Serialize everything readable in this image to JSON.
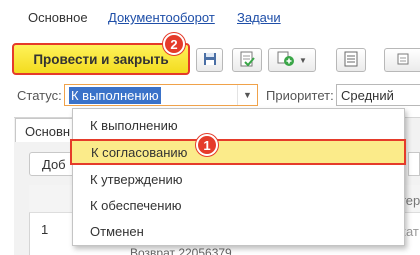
{
  "tabs": {
    "main": "Основное",
    "docflow": "Документооборот",
    "tasks": "Задачи"
  },
  "toolbar": {
    "post_close_label": "Провести и закрыть",
    "icons": [
      "save-icon",
      "post-icon",
      "create-based-icon",
      "report-icon"
    ]
  },
  "badges": {
    "step1": "1",
    "step2": "2"
  },
  "form": {
    "status_label": "Статус:",
    "status_value": "К выполнению",
    "priority_label": "Приоритет:",
    "priority_value": "Средний"
  },
  "status_dropdown": {
    "options": [
      "К выполнению",
      "К согласованию",
      "К утверждению",
      "К обеспечению",
      "Отменен"
    ],
    "highlighted_index": 1
  },
  "inner": {
    "tab_label": "Основн",
    "add_button_label": "Доб",
    "column_header_fragment": "тер",
    "row_number": "1",
    "row_cell_fragment": "кат",
    "row_bottom_fragment": "Возврат 22056379"
  },
  "colors": {
    "accent_yellow": "#f3dc1f",
    "highlight_red": "#e53b2a",
    "link_blue": "#1f4fa8",
    "selection_blue": "#3a72c9"
  }
}
